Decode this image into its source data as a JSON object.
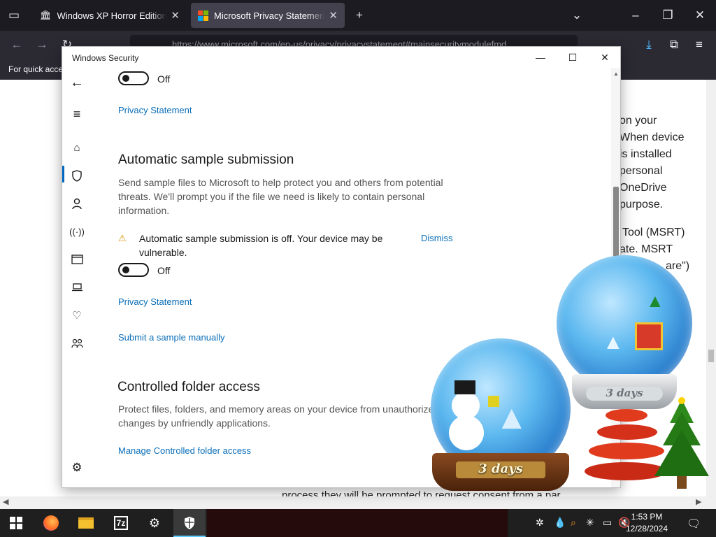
{
  "browser": {
    "tabs": [
      {
        "label": "Windows XP Horror Edition (De",
        "active": false
      },
      {
        "label": "Microsoft Privacy Statement – M",
        "active": true
      }
    ],
    "url": "https://www.microsoft.com/en-us/privacy/privacystatement#mainsecuritymodulefmd",
    "bookmarks_text": "For quick acce"
  },
  "page_bg": {
    "lines": [
      "on your",
      "When device",
      "is installed",
      "personal",
      "OneDrive",
      "purpose.",
      "Tool (MSRT)",
      "ate. MSRT",
      "are\")"
    ],
    "bottom_line": "process they will be prompted to request consent from a par"
  },
  "window": {
    "title": "Windows Security",
    "top_toggle_label": "Off",
    "privacy_link_1": "Privacy Statement",
    "sample_section": {
      "heading": "Automatic sample submission",
      "description": "Send sample files to Microsoft to help protect you and others from potential threats.  We'll prompt you if the file we need is likely to contain personal information.",
      "warning_icon": "warning-icon",
      "warning_text": "Automatic sample submission is off. Your device may be vulnerable.",
      "dismiss_label": "Dismiss",
      "toggle_label": "Off",
      "privacy_link": "Privacy Statement",
      "submit_link": "Submit a sample manually"
    },
    "cfa_section": {
      "heading": "Controlled folder access",
      "description": "Protect files, folders, and memory areas on your device from unauthorized changes by unfriendly applications.",
      "manage_link": "Manage Controlled folder access"
    },
    "nav_icons": [
      "back-arrow-icon",
      "hamburger-icon",
      "home-icon",
      "shield-icon",
      "person-icon",
      "wireless-icon",
      "app-browser-icon",
      "device-icon",
      "health-icon",
      "family-icon",
      "settings-icon"
    ]
  },
  "overlay": {
    "globe_left_label": "3 days",
    "globe_right_label": "3 days"
  },
  "taskbar": {
    "time": "1:53 PM",
    "date": "12/28/2024"
  },
  "colors": {
    "accent": "#0067c0",
    "link": "#0a6eb8",
    "taskbar": "#1f1f1f"
  }
}
